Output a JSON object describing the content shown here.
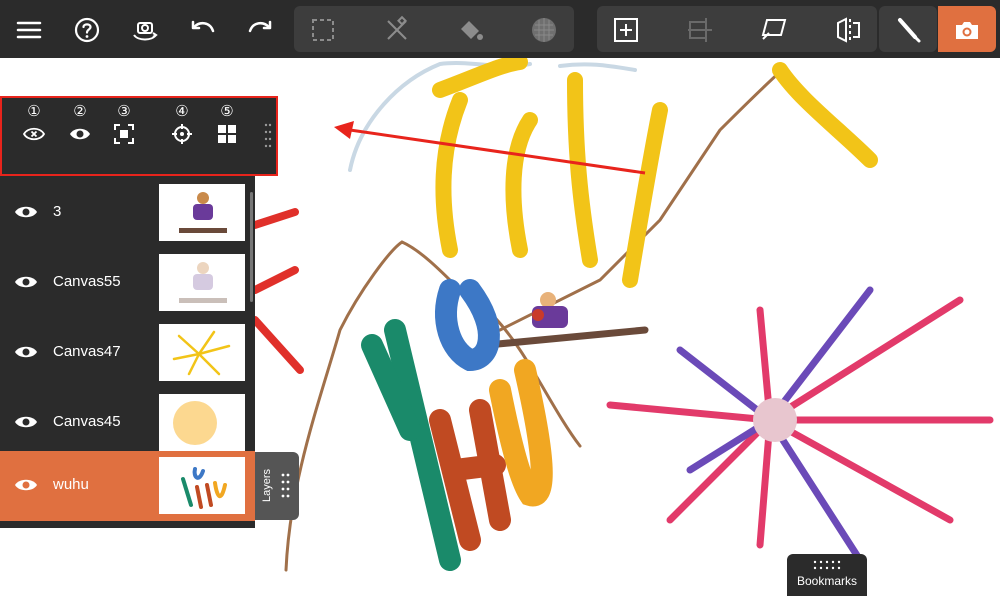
{
  "toolbar": {
    "left_icons": [
      "menu-icon",
      "help-icon",
      "camera-rotate-icon",
      "undo-icon",
      "redo-icon"
    ],
    "group1_icons": [
      "selection-icon",
      "ruler-pen-icon",
      "fill-bucket-icon",
      "texture-icon"
    ],
    "group2_icons": [
      "add-layer-icon",
      "transform-icon",
      "perspective-icon",
      "flip-icon"
    ],
    "right_icons": [
      "brush-icon",
      "camera-icon"
    ],
    "accent": "#e07040"
  },
  "layer_toolbar": {
    "items": [
      {
        "num": "①",
        "icon": "hide-eye-icon"
      },
      {
        "num": "②",
        "icon": "eye-icon"
      },
      {
        "num": "③",
        "icon": "focus-icon"
      },
      {
        "num": "④",
        "icon": "target-icon"
      },
      {
        "num": "⑤",
        "icon": "grid-icon"
      }
    ],
    "highlight_color": "#e8241c"
  },
  "layers": {
    "rows": [
      {
        "name": "3",
        "selected": false
      },
      {
        "name": "Canvas55",
        "selected": false
      },
      {
        "name": "Canvas47",
        "selected": false
      },
      {
        "name": "Canvas45",
        "selected": false
      },
      {
        "name": "wuhu",
        "selected": true
      }
    ],
    "tab_label": "Layers",
    "selected_color": "#e07040"
  },
  "bookmarks": {
    "label": "Bookmarks"
  }
}
